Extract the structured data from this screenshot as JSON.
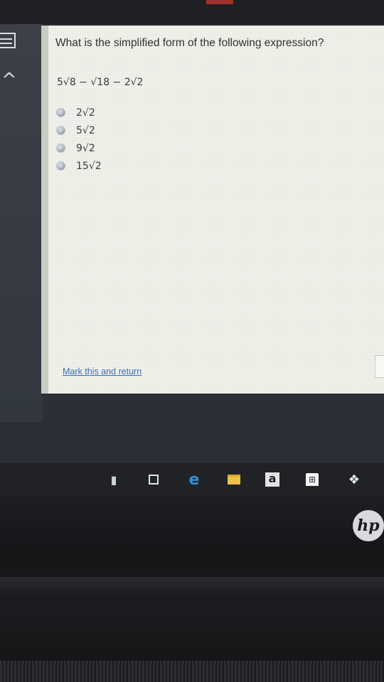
{
  "quiz": {
    "question": "What is the simplified form of the following expression?",
    "expression": "5√8 − √18 − 2√2",
    "options": [
      {
        "label": "2√2"
      },
      {
        "label": "5√2"
      },
      {
        "label": "9√2"
      },
      {
        "label": "15√2"
      }
    ],
    "mark_link": "Mark this and return"
  },
  "taskbar": {
    "icons": [
      "microphone-icon",
      "task-view-icon",
      "edge-icon",
      "file-explorer-icon",
      "amazon-icon",
      "store-icon",
      "dropbox-icon"
    ],
    "amazon_glyph": "a"
  },
  "device": {
    "brand": "hp"
  },
  "colors": {
    "link": "#3b6fb6",
    "panel_bg": "#f3f4ee",
    "taskbar_bg": "#202226"
  }
}
